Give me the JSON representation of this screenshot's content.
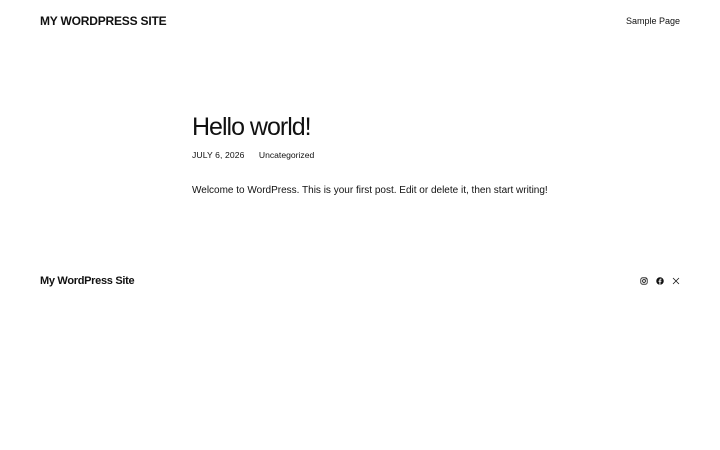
{
  "header": {
    "site_title": "MY WORDPRESS SITE",
    "nav": [
      {
        "label": "Sample Page"
      }
    ]
  },
  "post": {
    "title": "Hello world!",
    "date": "JULY 6, 2026",
    "category": "Uncategorized",
    "content": "Welcome to WordPress. This is your first post. Edit or delete it, then start writing!"
  },
  "footer": {
    "site_title": "My WordPress Site",
    "social_icons": [
      "instagram-icon",
      "facebook-icon",
      "x-icon"
    ]
  },
  "colors": {
    "text": "#111111",
    "background": "#ffffff"
  }
}
